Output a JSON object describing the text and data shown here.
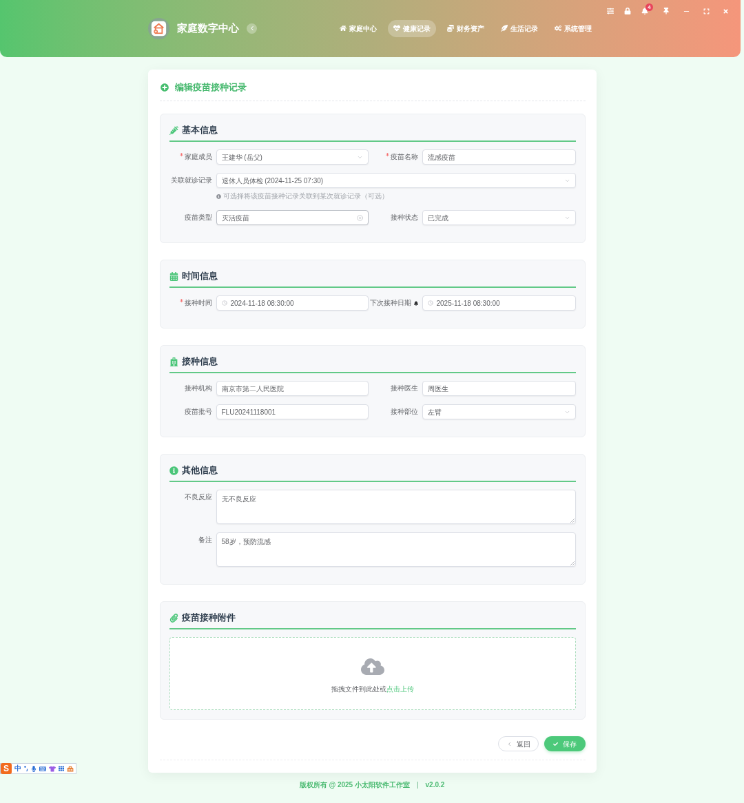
{
  "header": {
    "app_title": "家庭数字中心",
    "nav": [
      {
        "label": "家庭中心",
        "selected": false
      },
      {
        "label": "健康记录",
        "selected": true
      },
      {
        "label": "财务资产",
        "selected": false
      },
      {
        "label": "生活记录",
        "selected": false
      },
      {
        "label": "系统管理",
        "selected": false
      }
    ],
    "notification_count": "4"
  },
  "form": {
    "title": "编辑疫苗接种记录",
    "sections": [
      {
        "kind": "basic",
        "title": "基本信息",
        "rows": [
          [
            {
              "label": "家庭成员",
              "required": true,
              "kind": "select",
              "value": "王建华 (岳父)",
              "hovered": false
            },
            {
              "label": "疫苗名称",
              "required": true,
              "kind": "text",
              "value": "流感疫苗"
            }
          ],
          [
            {
              "label": "关联就诊记录",
              "required": false,
              "kind": "select",
              "value": "退休人员体检 (2024-11-25 07:30)",
              "hovered": false,
              "hint": "可选择将该疫苗接种记录关联到某次就诊记录（可选）"
            }
          ],
          [
            {
              "label": "疫苗类型",
              "required": false,
              "kind": "select",
              "value": "灭活疫苗",
              "hovered": true
            },
            {
              "label": "接种状态",
              "required": false,
              "kind": "select",
              "value": "已完成",
              "hovered": false
            }
          ]
        ]
      },
      {
        "kind": "time",
        "title": "时间信息",
        "rows": [
          [
            {
              "label": "接种时间",
              "required": true,
              "kind": "datetime",
              "value": "2024-11-18 08:30:00",
              "reminder": false
            },
            {
              "label": "下次接种日期",
              "required": false,
              "kind": "datetime",
              "value": "2025-11-18 08:30:00",
              "reminder": true
            }
          ]
        ]
      },
      {
        "kind": "clinic",
        "title": "接种信息",
        "rows": [
          [
            {
              "label": "接种机构",
              "required": false,
              "kind": "text",
              "value": "南京市第二人民医院"
            },
            {
              "label": "接种医生",
              "required": false,
              "kind": "text",
              "value": "周医生"
            }
          ],
          [
            {
              "label": "疫苗批号",
              "required": false,
              "kind": "text",
              "value": "FLU20241118001"
            },
            {
              "label": "接种部位",
              "required": false,
              "kind": "select",
              "value": "左臂",
              "hovered": false
            }
          ]
        ]
      },
      {
        "kind": "notes",
        "title": "其他信息",
        "rows": [
          [
            {
              "label": "不良反应",
              "required": false,
              "kind": "textarea",
              "value": "无不良反应"
            }
          ],
          [
            {
              "label": "备注",
              "required": false,
              "kind": "textarea",
              "value": "58岁，预防流感"
            }
          ]
        ]
      },
      {
        "kind": "attachment",
        "title": "疫苗接种附件",
        "upload": {
          "text": "拖拽文件到此处或",
          "link": "点击上传"
        }
      }
    ]
  },
  "buttons": [
    {
      "label": "返回",
      "kind": "back"
    },
    {
      "label": "保存",
      "kind": "save"
    }
  ],
  "footer": {
    "copyright": "版权所有 @ 2025 小太阳软件工作室",
    "separator": "|",
    "version": "v2.0.2"
  },
  "ime_toolbar": {
    "logo": "S",
    "mode": "中"
  }
}
